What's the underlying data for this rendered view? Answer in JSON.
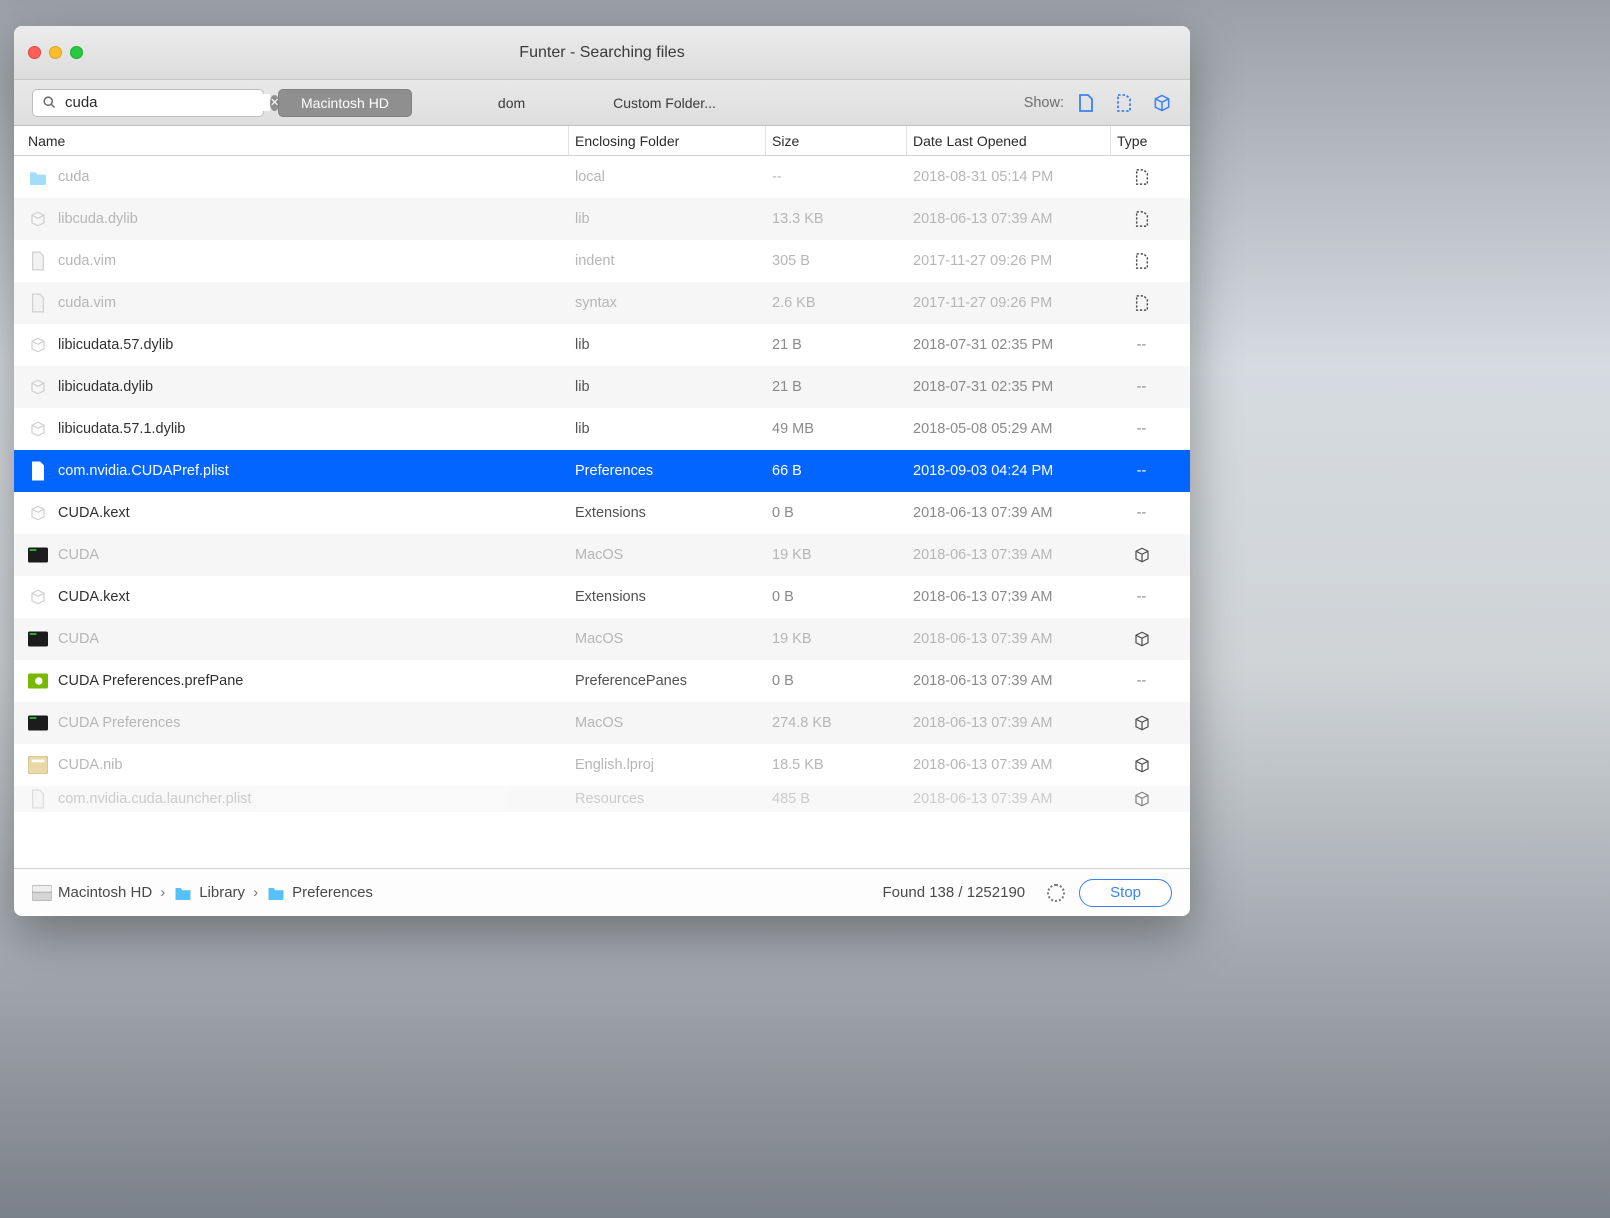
{
  "title": "Funter - Searching files",
  "search": {
    "value": "cuda"
  },
  "scopes": [
    "Macintosh HD",
    "dom",
    "Custom Folder..."
  ],
  "scopeActiveIndex": 0,
  "showLabel": "Show:",
  "columns": {
    "name": "Name",
    "enclosing": "Enclosing Folder",
    "size": "Size",
    "date": "Date Last Opened",
    "type": "Type"
  },
  "rows": [
    {
      "icon": "folder",
      "name": "cuda",
      "enc": "local",
      "size": "--",
      "date": "2018-08-31 05:14 PM",
      "type": "hidden",
      "dim": true,
      "alt": false
    },
    {
      "icon": "pkg",
      "name": "libcuda.dylib",
      "enc": "lib",
      "size": "13.3 KB",
      "date": "2018-06-13 07:39 AM",
      "type": "hidden",
      "dim": true,
      "alt": true
    },
    {
      "icon": "doc",
      "name": "cuda.vim",
      "enc": "indent",
      "size": "305 B",
      "date": "2017-11-27 09:26 PM",
      "type": "hidden",
      "dim": true,
      "alt": false
    },
    {
      "icon": "doc",
      "name": "cuda.vim",
      "enc": "syntax",
      "size": "2.6 KB",
      "date": "2017-11-27 09:26 PM",
      "type": "hidden",
      "dim": true,
      "alt": true
    },
    {
      "icon": "pkg",
      "name": "libicudata.57.dylib",
      "enc": "lib",
      "size": "21 B",
      "date": "2018-07-31 02:35 PM",
      "type": "--",
      "dim": false,
      "alt": false
    },
    {
      "icon": "pkg",
      "name": "libicudata.dylib",
      "enc": "lib",
      "size": "21 B",
      "date": "2018-07-31 02:35 PM",
      "type": "--",
      "dim": false,
      "alt": true
    },
    {
      "icon": "pkg",
      "name": "libicudata.57.1.dylib",
      "enc": "lib",
      "size": "49 MB",
      "date": "2018-05-08 05:29 AM",
      "type": "--",
      "dim": false,
      "alt": false
    },
    {
      "icon": "doc",
      "name": "com.nvidia.CUDAPref.plist",
      "enc": "Preferences",
      "size": "66 B",
      "date": "2018-09-03 04:24 PM",
      "type": "--",
      "dim": false,
      "alt": true,
      "selected": true
    },
    {
      "icon": "pkg",
      "name": "CUDA.kext",
      "enc": "Extensions",
      "size": "0 B",
      "date": "2018-06-13 07:39 AM",
      "type": "--",
      "dim": false,
      "alt": false
    },
    {
      "icon": "exec",
      "name": "CUDA",
      "enc": "MacOS",
      "size": "19 KB",
      "date": "2018-06-13 07:39 AM",
      "type": "cube",
      "dim": true,
      "alt": true
    },
    {
      "icon": "pkg",
      "name": "CUDA.kext",
      "enc": "Extensions",
      "size": "0 B",
      "date": "2018-06-13 07:39 AM",
      "type": "--",
      "dim": false,
      "alt": false
    },
    {
      "icon": "exec",
      "name": "CUDA",
      "enc": "MacOS",
      "size": "19 KB",
      "date": "2018-06-13 07:39 AM",
      "type": "cube",
      "dim": true,
      "alt": true
    },
    {
      "icon": "prefpane",
      "name": "CUDA Preferences.prefPane",
      "enc": "PreferencePanes",
      "size": "0 B",
      "date": "2018-06-13 07:39 AM",
      "type": "--",
      "dim": false,
      "alt": false
    },
    {
      "icon": "exec",
      "name": "CUDA Preferences",
      "enc": "MacOS",
      "size": "274.8 KB",
      "date": "2018-06-13 07:39 AM",
      "type": "cube",
      "dim": true,
      "alt": true
    },
    {
      "icon": "nib",
      "name": "CUDA.nib",
      "enc": "English.lproj",
      "size": "18.5 KB",
      "date": "2018-06-13 07:39 AM",
      "type": "cube",
      "dim": true,
      "alt": false
    },
    {
      "icon": "doc",
      "name": "com.nvidia.cuda.launcher.plist",
      "enc": "Resources",
      "size": "485 B",
      "date": "2018-06-13 07:39 AM",
      "type": "cube",
      "dim": true,
      "alt": true,
      "partial": true
    }
  ],
  "breadcrumb": [
    "Macintosh HD",
    "Library",
    "Preferences"
  ],
  "foundLabel": "Found 138 / 1252190",
  "stopLabel": "Stop"
}
